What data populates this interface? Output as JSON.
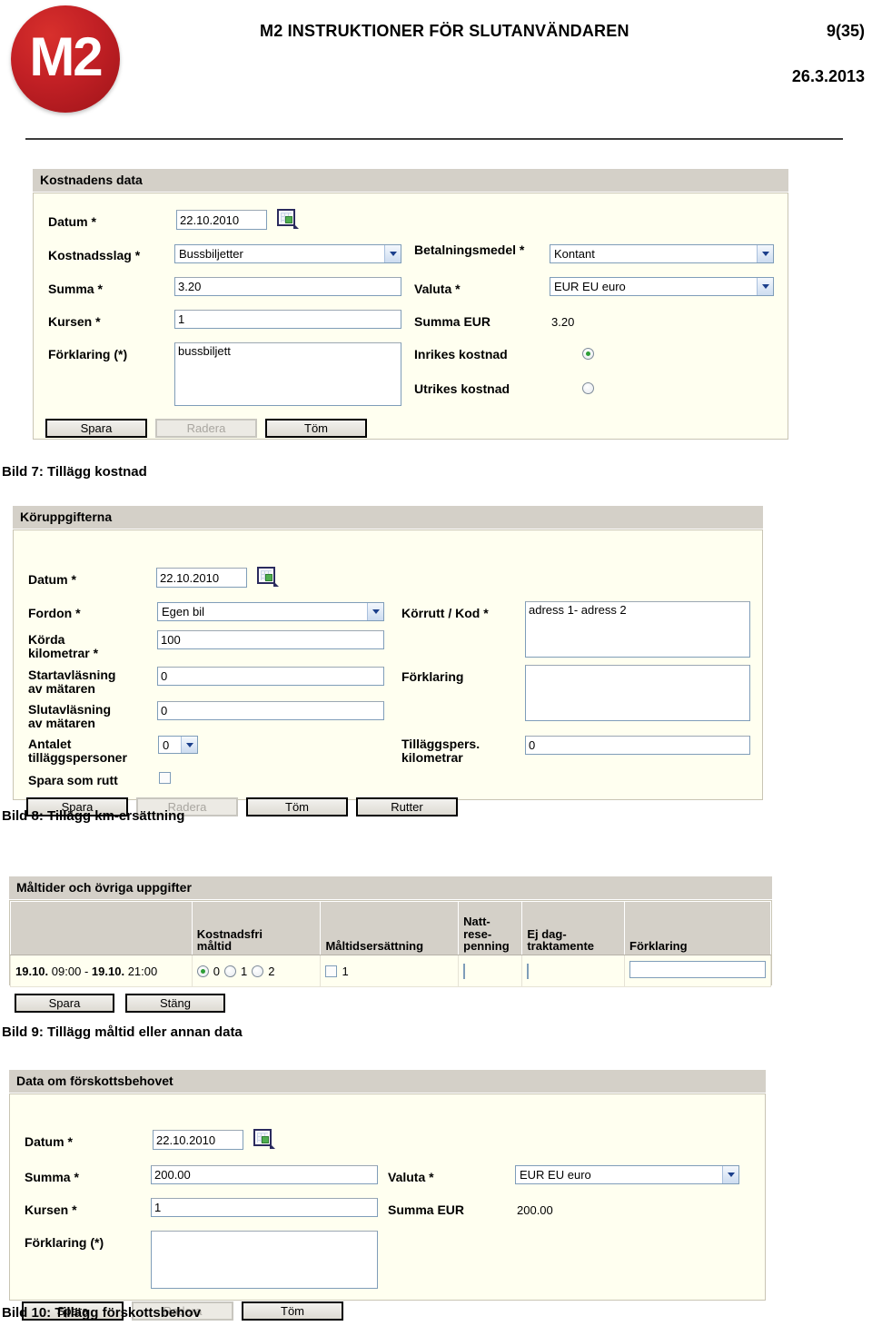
{
  "header": {
    "logo_text": "M2",
    "title": "M2 INSTRUKTIONER FÖR SLUTANVÄNDAREN",
    "page_number": "9(35)",
    "date": "26.3.2013"
  },
  "cost_form": {
    "section_title": "Kostnadens data",
    "labels": {
      "datum": "Datum *",
      "kostnadsslag": "Kostnadsslag *",
      "betalningsmedel": "Betalningsmedel *",
      "summa": "Summa *",
      "valuta": "Valuta *",
      "kursen": "Kursen *",
      "summa_eur": "Summa EUR",
      "forklaring": "Förklaring (*)",
      "inrikes": "Inrikes kostnad",
      "utrikes": "Utrikes kostnad"
    },
    "values": {
      "datum": "22.10.2010",
      "kostnadsslag": "Bussbiljetter",
      "betalningsmedel": "Kontant",
      "summa": "3.20",
      "valuta": "EUR EU euro",
      "kursen": "1",
      "summa_eur": "3.20",
      "forklaring": "bussbiljett",
      "inrikes_selected": true,
      "utrikes_selected": false
    },
    "buttons": [
      {
        "label": "Spara",
        "disabled": false
      },
      {
        "label": "Radera",
        "disabled": true
      },
      {
        "label": "Töm",
        "disabled": false
      }
    ]
  },
  "caption_7": "Bild 7: Tillägg kostnad",
  "drive_form": {
    "section_title": "Köruppgifterna",
    "labels": {
      "datum": "Datum *",
      "fordon": "Fordon *",
      "korrutt": "Körrutt / Kod *",
      "korda_km": "Körda\nkilometrar *",
      "startavlasning": "Startavläsning\nav mätaren",
      "forklaring": "Förklaring",
      "slutavlasning": "Slutavläsning\nav mätaren",
      "antalet": "Antalet\ntilläggspersoner",
      "tillaggspers_km": "Tilläggspers.\nkilometrar",
      "spara_som_rutt": "Spara som rutt"
    },
    "values": {
      "datum": "22.10.2010",
      "fordon": "Egen bil",
      "korrutt": "adress 1- adress 2",
      "korda_km": "100",
      "startavlasning": "0",
      "forklaring": "",
      "slutavlasning": "0",
      "antalet": "0",
      "tillaggspers_km": "0",
      "spara_som_rutt_checked": false
    },
    "buttons": [
      {
        "label": "Spara",
        "disabled": false
      },
      {
        "label": "Radera",
        "disabled": true
      },
      {
        "label": "Töm",
        "disabled": false
      },
      {
        "label": "Rutter",
        "disabled": false
      }
    ]
  },
  "caption_8": "Bild 8: Tillägg km-ersättning",
  "meal_form": {
    "section_title": "Måltider och övriga uppgifter",
    "columns": [
      "",
      "Kostnadsfri måltid",
      "Måltidsersättning",
      "Natt-rese-penning",
      "Ej dag-traktamente",
      "Förklaring"
    ],
    "column_lines": {
      "kostnadsfri": [
        "Kostnadsfri",
        "måltid"
      ],
      "maltidsersattning": [
        "Måltidsersättning"
      ],
      "nattresepenning": [
        "Natt-",
        "rese-",
        "penning"
      ],
      "ej_dagtraktamente": [
        "Ej dag-",
        "traktamente"
      ],
      "forklaring": [
        "Förklaring"
      ]
    },
    "row": {
      "date_from": "19.10.",
      "time_from": "09:00",
      "dash": "-",
      "date_to": "19.10.",
      "time_to": "21:00",
      "free_meal_options": [
        "0",
        "1",
        "2"
      ],
      "free_meal_selected": "0",
      "maltidsersattning_label": "1",
      "maltidsersattning_checked": false,
      "nattresepenning_checked": false,
      "ej_dagtraktamente_checked": false,
      "forklaring": ""
    },
    "buttons": [
      {
        "label": "Spara",
        "disabled": false
      },
      {
        "label": "Stäng",
        "disabled": false
      }
    ]
  },
  "caption_9": "Bild 9: Tillägg måltid eller annan data",
  "advance_form": {
    "section_title": "Data om förskottsbehovet",
    "labels": {
      "datum": "Datum *",
      "summa": "Summa *",
      "valuta": "Valuta *",
      "kursen": "Kursen *",
      "summa_eur": "Summa EUR",
      "forklaring": "Förklaring (*)"
    },
    "values": {
      "datum": "22.10.2010",
      "summa": "200.00",
      "valuta": "EUR EU euro",
      "kursen": "1",
      "summa_eur": "200.00",
      "forklaring": ""
    },
    "buttons": [
      {
        "label": "Spara",
        "disabled": false
      },
      {
        "label": "Radera",
        "disabled": true
      },
      {
        "label": "Töm",
        "disabled": false
      }
    ]
  },
  "caption_10": "Bild 10: Tillägg förskottsbehov",
  "icons": {
    "calendar": "calendar-picker-icon",
    "dropdown": "chevron-down-icon"
  }
}
